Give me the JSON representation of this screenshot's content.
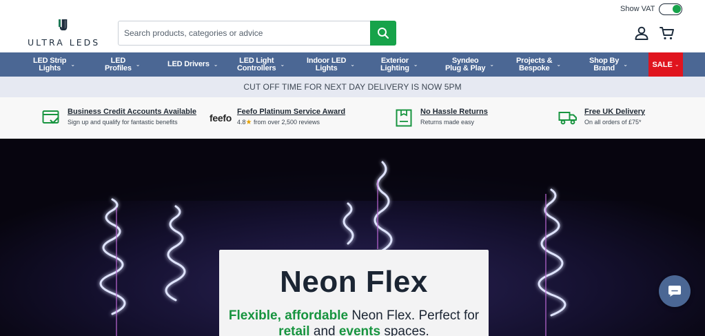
{
  "header": {
    "logo_text": "ULTRA LEDS",
    "search": {
      "placeholder": "Search products, categories or advice"
    },
    "vat_label": "Show VAT",
    "vat_enabled": true,
    "icons": {
      "search": "search-icon",
      "account": "user-icon",
      "cart": "cart-icon"
    },
    "colors": {
      "brand": "#1e2d3d",
      "accent_green": "#17a34a"
    }
  },
  "nav": {
    "items": [
      {
        "label": "LED Strip\nLights"
      },
      {
        "label": "LED\nProfiles"
      },
      {
        "label": "LED Drivers"
      },
      {
        "label": "LED Light\nControllers"
      },
      {
        "label": "Indoor LED\nLights"
      },
      {
        "label": "Exterior\nLighting"
      },
      {
        "label": "Syndeo\nPlug & Play"
      },
      {
        "label": "Projects &\nBespoke"
      },
      {
        "label": "Shop By\nBrand"
      }
    ],
    "sale_label": "SALE",
    "colors": {
      "bar": "#4b6794",
      "sale": "#e0141e"
    }
  },
  "announcement": "CUT OFF TIME FOR NEXT DAY DELIVERY IS NOW 5PM",
  "usps": [
    {
      "icon": "credit-account-icon",
      "title": "Business Credit Accounts Available",
      "sub": "Sign up and qualify for fantastic benefits"
    },
    {
      "icon": "feefo-logo",
      "logo_text": "feefo",
      "title": "Feefo Platinum Service Award",
      "rating": "4.8",
      "sub": "from over 2,500 reviews"
    },
    {
      "icon": "returns-icon",
      "title": "No Hassle Returns",
      "sub": "Returns made easy"
    },
    {
      "icon": "delivery-truck-icon",
      "title": "Free UK Delivery",
      "sub": "On all orders of £75*"
    }
  ],
  "hero": {
    "title": "Neon Flex",
    "subtitle": {
      "w1": "Flexible,",
      "w2": "affordable",
      "t1": " Neon Flex. Perfect for",
      "w3": "retail",
      "t2": " and ",
      "w4": "events",
      "t3": " spaces."
    }
  },
  "chat": {
    "icon": "chat-icon"
  }
}
